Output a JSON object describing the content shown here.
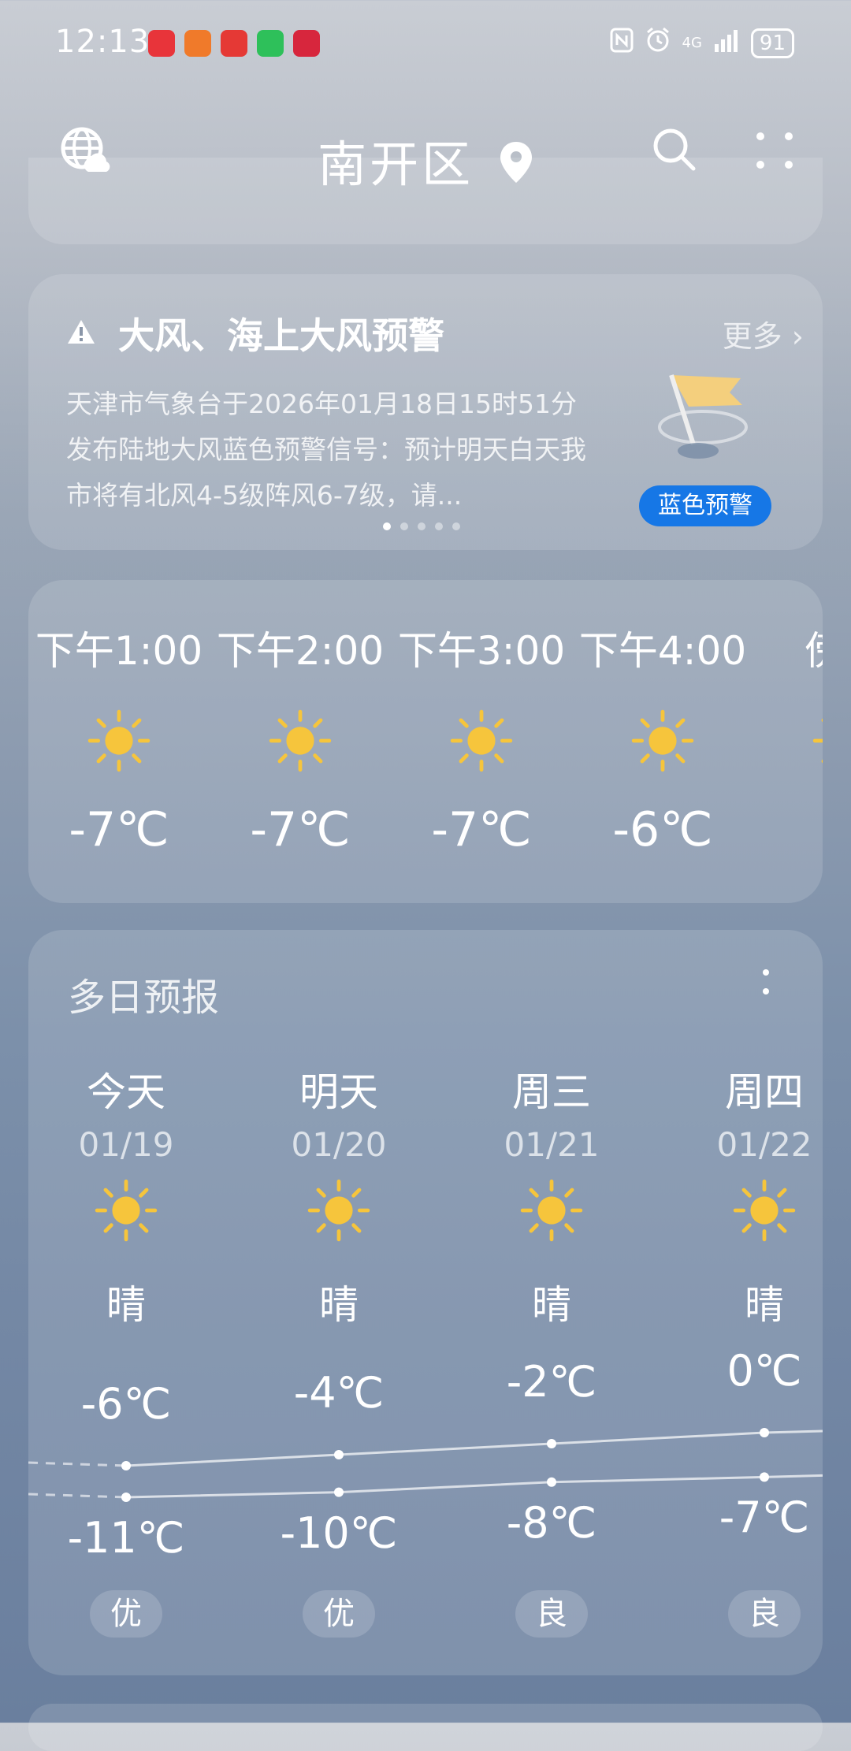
{
  "status": {
    "time": "12:13",
    "network": "4G",
    "battery": "91"
  },
  "header": {
    "city": "南开区"
  },
  "warning": {
    "title": "大风、海上大风预警",
    "more": "更多 ›",
    "body": "天津市气象台于2026年01月18日15时51分发布陆地大风蓝色预警信号：预计明天白天我市将有北风4-5级阵风6-7级，请...",
    "badge": "蓝色预警"
  },
  "hourly": [
    {
      "time": "下午1:00",
      "icon": "sun-icon",
      "temp": "-7℃"
    },
    {
      "time": "下午2:00",
      "icon": "sun-icon",
      "temp": "-7℃"
    },
    {
      "time": "下午3:00",
      "icon": "sun-icon",
      "temp": "-7℃"
    },
    {
      "time": "下午4:00",
      "icon": "sun-icon",
      "temp": "-6℃"
    },
    {
      "time": "傍晚",
      "icon": "sun-icon",
      "temp": "-"
    }
  ],
  "multiday": {
    "title": "多日预报",
    "days": [
      {
        "name": "今天",
        "date": "01/19",
        "icon": "sun-icon",
        "cond": "晴",
        "high": "-6℃",
        "low": "-11℃",
        "aqi": "优"
      },
      {
        "name": "明天",
        "date": "01/20",
        "icon": "sun-icon",
        "cond": "晴",
        "high": "-4℃",
        "low": "-10℃",
        "aqi": "优"
      },
      {
        "name": "周三",
        "date": "01/21",
        "icon": "sun-icon",
        "cond": "晴",
        "high": "-2℃",
        "low": "-8℃",
        "aqi": "良"
      },
      {
        "name": "周四",
        "date": "01/22",
        "icon": "sun-icon",
        "cond": "晴",
        "high": "0℃",
        "low": "-7℃",
        "aqi": "良"
      }
    ]
  },
  "colors": {
    "badge_blue": "#1677e6",
    "sun_yellow": "#f6c53c"
  }
}
